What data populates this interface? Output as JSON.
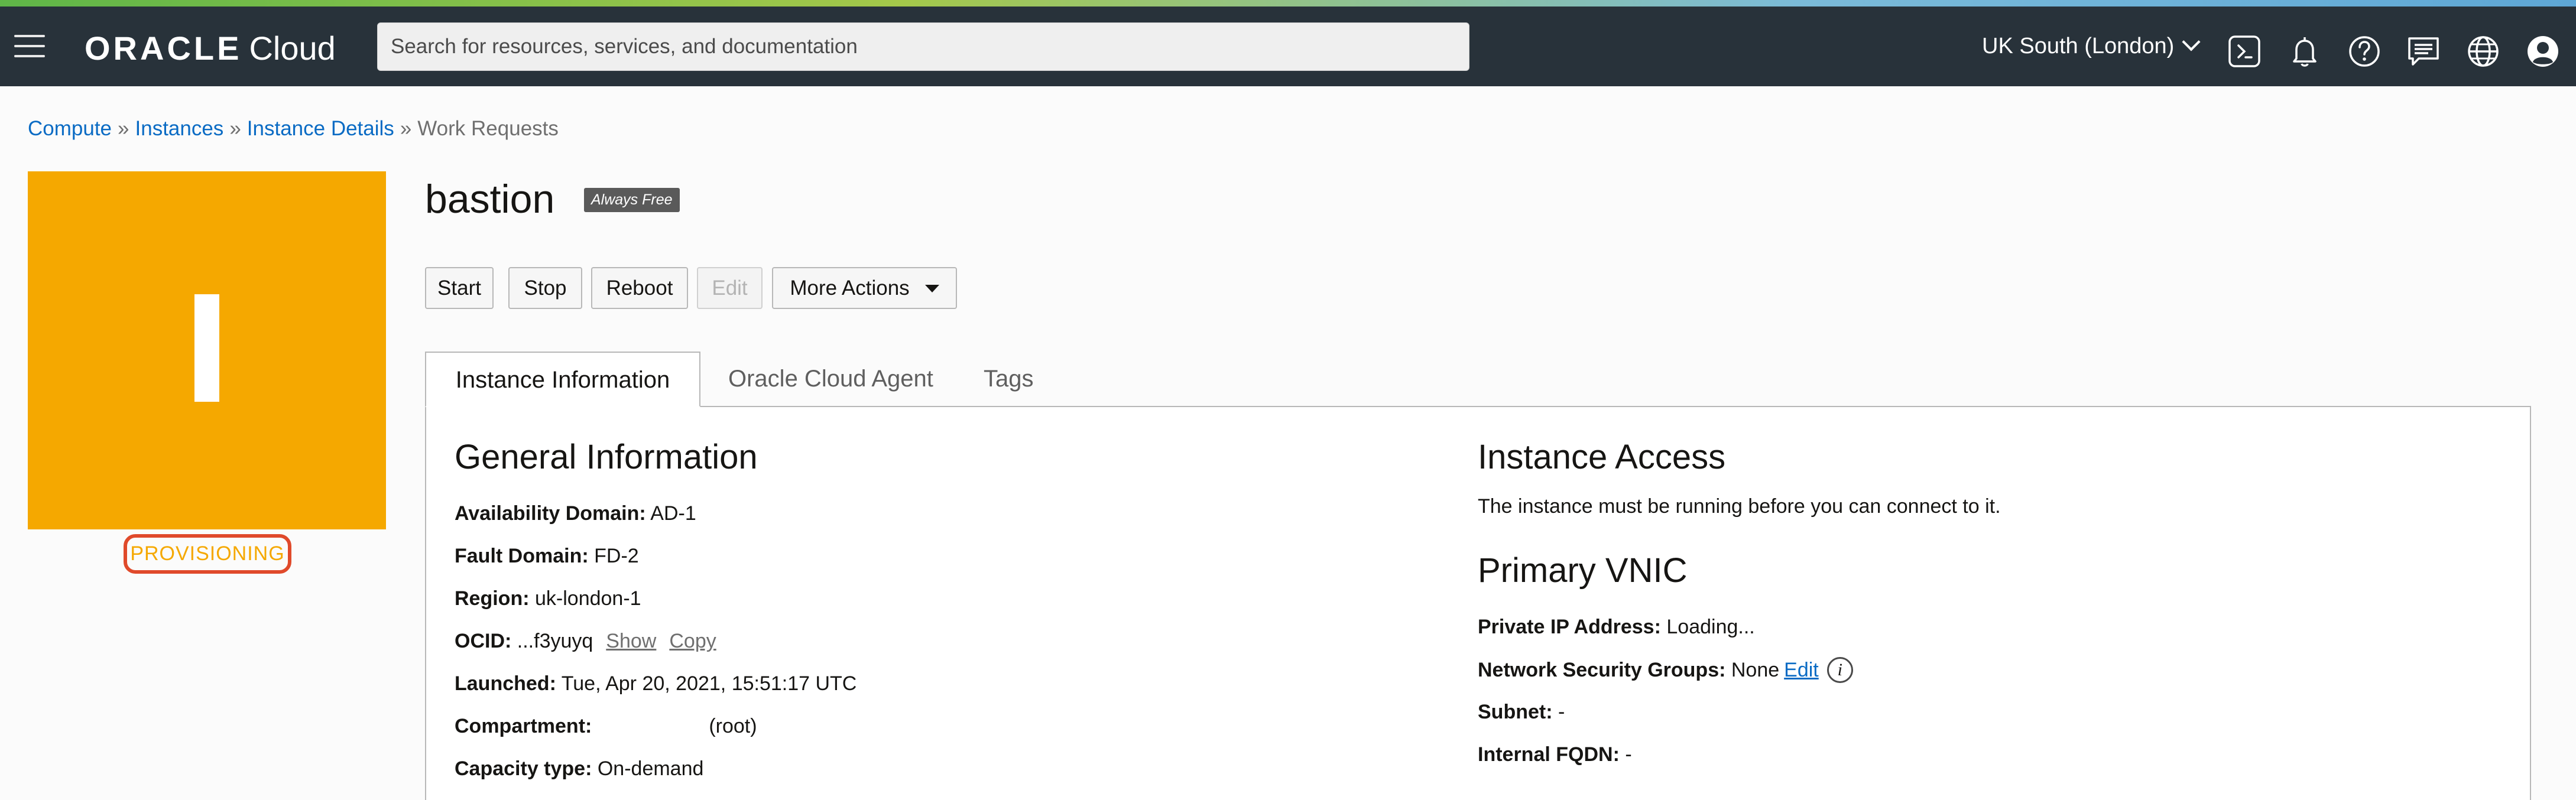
{
  "header": {
    "brand": "ORACLE",
    "brand_suffix": "Cloud",
    "search_placeholder": "Search for resources, services, and documentation",
    "region": "UK South (London)",
    "icons": [
      "cloud-shell-icon",
      "bell-icon",
      "help-icon",
      "chat-icon",
      "globe-icon",
      "user-avatar-icon"
    ]
  },
  "breadcrumb": {
    "items": [
      "Compute",
      "Instances",
      "Instance Details"
    ],
    "current": "Work Requests",
    "separator": "»"
  },
  "instance": {
    "letter": "I",
    "state": "PROVISIONING",
    "name": "bastion",
    "tag": "Always Free",
    "tile_color": "#f5a800",
    "state_border_color": "#e04a2b"
  },
  "actions": {
    "start": "Start",
    "stop": "Stop",
    "reboot": "Reboot",
    "edit": "Edit",
    "more": "More Actions"
  },
  "tabs": [
    "Instance Information",
    "Oracle Cloud Agent",
    "Tags"
  ],
  "general_info": {
    "title": "General Information",
    "availability_domain_label": "Availability Domain:",
    "availability_domain": "AD-1",
    "fault_domain_label": "Fault Domain:",
    "fault_domain": "FD-2",
    "region_label": "Region:",
    "region": "uk-london-1",
    "ocid_label": "OCID:",
    "ocid": "...f3yuyq",
    "show": "Show",
    "copy": "Copy",
    "launched_label": "Launched:",
    "launched": "Tue, Apr 20, 2021, 15:51:17 UTC",
    "compartment_label": "Compartment:",
    "compartment": "(root)",
    "capacity_label": "Capacity type:",
    "capacity": "On-demand"
  },
  "instance_access": {
    "title": "Instance Access",
    "message": "The instance must be running before you can connect to it."
  },
  "primary_vnic": {
    "title": "Primary VNIC",
    "private_ip_label": "Private IP Address:",
    "private_ip": "Loading...",
    "nsg_label": "Network Security Groups:",
    "nsg": "None",
    "nsg_edit": "Edit",
    "subnet_label": "Subnet:",
    "subnet": "-",
    "fqdn_label": "Internal FQDN:",
    "fqdn": "-"
  }
}
